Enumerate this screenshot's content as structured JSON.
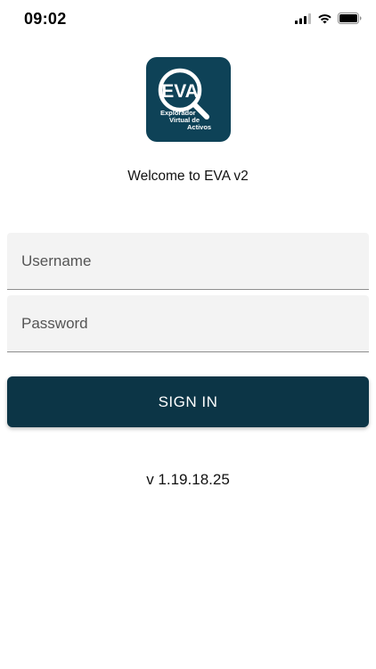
{
  "status_bar": {
    "time": "09:02",
    "icons": [
      "cellular-signal-icon",
      "wifi-icon",
      "battery-icon"
    ]
  },
  "logo": {
    "main_text": "EVA",
    "line1": "Explorador",
    "line2": "Virtual de",
    "line3": "Activos",
    "color": "#0e4257"
  },
  "welcome": "Welcome to EVA v2",
  "form": {
    "username_placeholder": "Username",
    "password_placeholder": "Password",
    "sign_in_label": "SIGN IN"
  },
  "version": "v 1.19.18.25",
  "colors": {
    "brand": "#0e4257",
    "button": "#0c3546",
    "field_background": "#f3f3f3"
  }
}
